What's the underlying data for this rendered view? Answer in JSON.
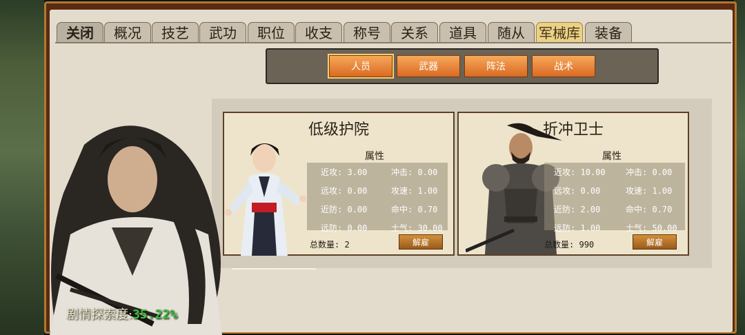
{
  "tabs": [
    "关闭",
    "概况",
    "技艺",
    "武功",
    "职位",
    "收支",
    "称号",
    "关系",
    "道具",
    "随从",
    "军械库",
    "装备"
  ],
  "active_tab_index": 10,
  "subtabs": [
    "人员",
    "武器",
    "阵法",
    "战术"
  ],
  "active_subtab_index": 0,
  "cards": [
    {
      "name": "低级护院",
      "attr_title": "属性",
      "stats": [
        {
          "label": "近攻",
          "value": "3.00"
        },
        {
          "label": "冲击",
          "value": "0.00"
        },
        {
          "label": "远攻",
          "value": "0.00"
        },
        {
          "label": "攻速",
          "value": "1.00"
        },
        {
          "label": "近防",
          "value": "0.00"
        },
        {
          "label": "命中",
          "value": "0.70"
        },
        {
          "label": "远防",
          "value": "0.00"
        },
        {
          "label": "士气",
          "value": "30.00"
        }
      ],
      "count_label": "总数量",
      "count": "2",
      "dismiss": "解雇"
    },
    {
      "name": "折冲卫士",
      "attr_title": "属性",
      "stats": [
        {
          "label": "近攻",
          "value": "10.00"
        },
        {
          "label": "冲击",
          "value": "0.00"
        },
        {
          "label": "远攻",
          "value": "0.00"
        },
        {
          "label": "攻速",
          "value": "1.00"
        },
        {
          "label": "近防",
          "value": "2.00"
        },
        {
          "label": "命中",
          "value": "0.70"
        },
        {
          "label": "远防",
          "value": "1.00"
        },
        {
          "label": "士气",
          "value": "50.00"
        }
      ],
      "count_label": "总数量",
      "count": "990",
      "dismiss": "解雇"
    }
  ],
  "progress": {
    "label": "剧情探索度:",
    "value": "35.22%"
  },
  "icons": [
    "swordsman-portrait",
    "young-guard-portrait",
    "armored-guard-portrait"
  ],
  "colors": {
    "active_tab": "#e8d28a",
    "subtab": "#e4803a",
    "progress_value": "#36c23a"
  }
}
